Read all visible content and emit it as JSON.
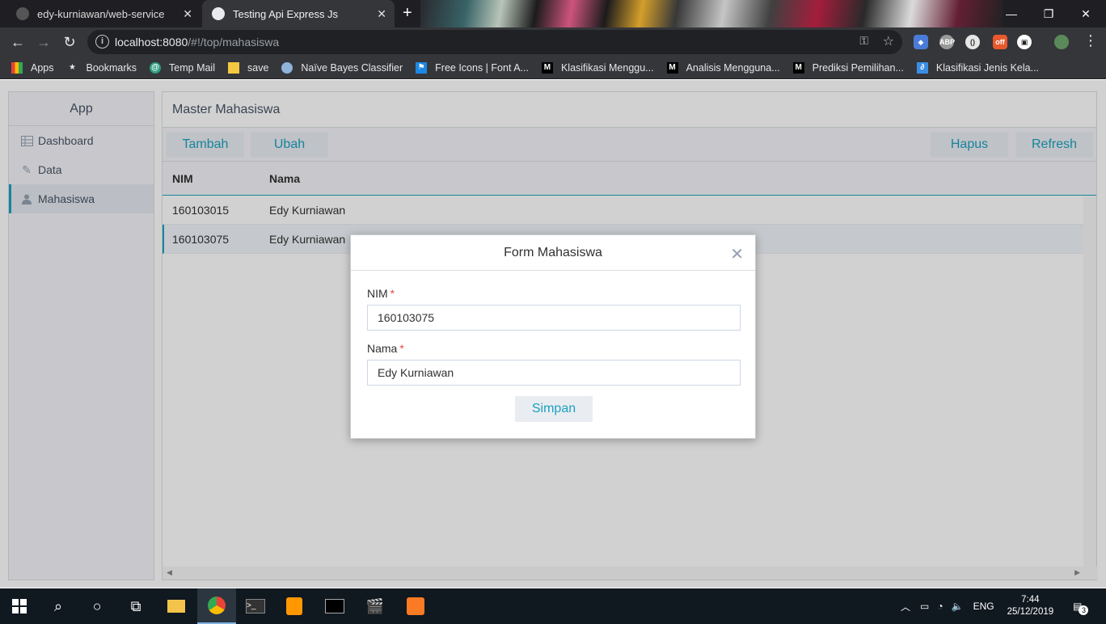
{
  "browser": {
    "tabs": [
      {
        "title": "edy-kurniawan/web-service",
        "active": false
      },
      {
        "title": "Testing Api Express Js",
        "active": true
      }
    ],
    "url_host": "localhost:8080",
    "url_path": "/#!/top/mahasiswa",
    "bookmarks": [
      "Apps",
      "Bookmarks",
      "Temp Mail",
      "save",
      "Naïve Bayes Classifier",
      "Free Icons | Font A...",
      "Klasifikasi Menggu...",
      "Analisis Mengguna...",
      "Prediksi Pemilihan...",
      "Klasifikasi Jenis Kela..."
    ]
  },
  "app": {
    "title": "App",
    "sidebar": [
      {
        "label": "Dashboard",
        "icon": "table-icon"
      },
      {
        "label": "Data",
        "icon": "pencil-icon"
      },
      {
        "label": "Mahasiswa",
        "icon": "user-icon",
        "active": true
      }
    ],
    "header": "Master Mahasiswa",
    "buttons": {
      "add": "Tambah",
      "edit": "Ubah",
      "delete": "Hapus",
      "refresh": "Refresh"
    },
    "grid": {
      "columns": [
        "NIM",
        "Nama"
      ],
      "rows": [
        {
          "nim": "160103015",
          "nama": "Edy Kurniawan"
        },
        {
          "nim": "160103075",
          "nama": "Edy Kurniawan",
          "selected": true
        }
      ]
    },
    "modal": {
      "title": "Form Mahasiswa",
      "nim_label": "NIM",
      "nim_value": "160103075",
      "nama_label": "Nama",
      "nama_value": "Edy Kurniawan",
      "required_mark": "*",
      "save": "Simpan"
    }
  },
  "taskbar": {
    "lang": "ENG",
    "time": "7:44",
    "date": "25/12/2019",
    "notifications": "3"
  },
  "colors": {
    "accent": "#1CA1C1",
    "sidebar_bg": "#f4f5f9",
    "taskbar": "#101820"
  }
}
